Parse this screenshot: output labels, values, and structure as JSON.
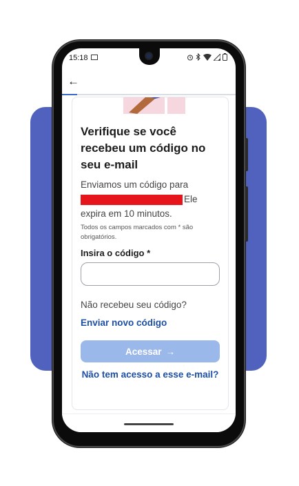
{
  "status_bar": {
    "time": "15:18",
    "icons": [
      "alarm-icon",
      "bluetooth-icon",
      "wifi-icon",
      "signal-icon",
      "battery-icon"
    ]
  },
  "header": {
    "back_icon": "arrow-left-icon"
  },
  "form": {
    "title_lines": [
      "Verifique se você",
      "recebeu um código no",
      "seu e-mail"
    ],
    "sent_prefix": "Enviamos um código para",
    "sent_suffix": "Ele",
    "sent_line3": "expira em 10 minutos.",
    "required_note": "Todos os campos marcados com * são obrigatórios.",
    "code_label": "Insira o código *",
    "code_value": "",
    "not_received": "Não recebeu seu código?",
    "resend_link": "Enviar novo código",
    "submit_label": "Acessar",
    "submit_arrow": "→",
    "no_access_link": "Não tem acesso a esse e-mail?"
  },
  "colors": {
    "accent": "#1d4fa6",
    "button_disabled": "#9bb8ea",
    "backdrop": "#5062bd",
    "redaction": "#e6141b"
  }
}
